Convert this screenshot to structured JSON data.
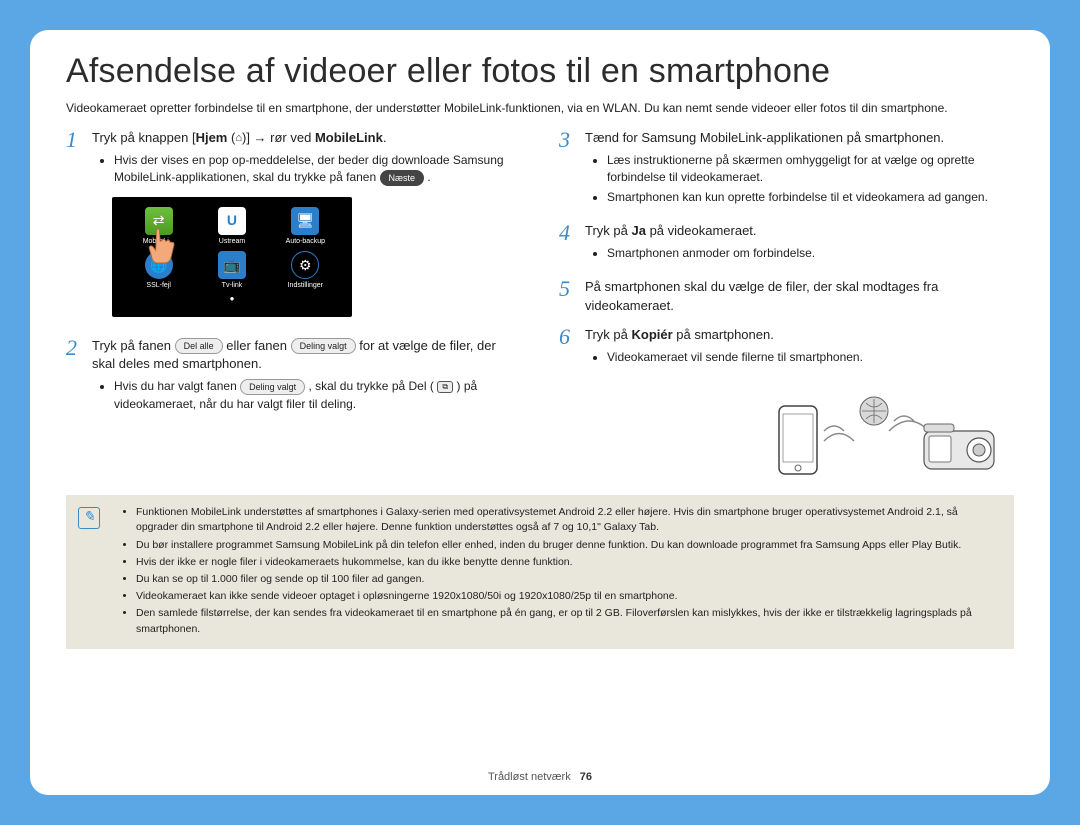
{
  "title": "Afsendelse af videoer eller fotos til en smartphone",
  "intro": "Videokameraet opretter forbindelse til en smartphone, der understøtter MobileLink-funktionen, via en WLAN. Du kan nemt sende videoer eller fotos til din smartphone.",
  "steps": {
    "s1": {
      "num": "1",
      "pre": "Tryk på knappen [",
      "hjem": "Hjem",
      "home_icon": "⌂",
      "post": ")] → rør ved ",
      "ml": "MobileLink",
      "bullet_a": "Hvis der vises en pop op-meddelelse, der beder dig downloade Samsung MobileLink-applikationen, skal du trykke på fanen",
      "pill_next": "Næste"
    },
    "s2": {
      "num": "2",
      "pre": "Tryk på fanen ",
      "pill_all": "Del alle",
      "mid": " eller fanen ",
      "pill_sel": "Deling valgt",
      "post": " for at vælge de filer, der skal deles med smartphonen.",
      "bullet_pre": "Hvis du har valgt fanen ",
      "bullet_pill": "Deling valgt",
      "bullet_mid": ", skal du trykke på Del (",
      "bullet_post": ") på videokameraet, når du har valgt filer til deling."
    },
    "s3": {
      "num": "3",
      "main": "Tænd for Samsung MobileLink-applikationen på smartphonen.",
      "b1": "Læs instruktionerne på skærmen omhyggeligt for at vælge og oprette forbindelse til videokameraet.",
      "b2": "Smartphonen kan kun oprette forbindelse til et videokamera ad gangen."
    },
    "s4": {
      "num": "4",
      "pre": "Tryk på ",
      "ja": "Ja",
      "post": " på videokameraet.",
      "b1": "Smartphonen anmoder om forbindelse."
    },
    "s5": {
      "num": "5",
      "main": "På smartphonen skal du vælge de filer, der skal modtages fra videokameraet."
    },
    "s6": {
      "num": "6",
      "pre": "Tryk på ",
      "kopier": "Kopiér",
      "post": " på smartphonen.",
      "b1": "Videokameraet vil sende filerne til smartphonen."
    }
  },
  "screen": {
    "apps": [
      "MobileLi...",
      "Ustream",
      "Auto-backup",
      "SSL-fejl",
      "Tv-link",
      "Indstillinger"
    ],
    "u_letter": "U"
  },
  "notes": {
    "n1": "Funktionen MobileLink understøttes af smartphones i Galaxy-serien med operativsystemet Android 2.2 eller højere. Hvis din smartphone bruger operativsystemet Android 2.1, så opgrader din smartphone til Android 2.2 eller højere. Denne funktion understøttes også af 7 og 10,1\" Galaxy Tab.",
    "n2": "Du bør installere programmet Samsung MobileLink på din telefon eller enhed, inden du bruger denne funktion. Du kan downloade programmet fra Samsung Apps eller Play Butik.",
    "n3": "Hvis der ikke er nogle filer i videokameraets hukommelse, kan du ikke benytte denne funktion.",
    "n4": "Du kan se op til 1.000 filer og sende op til 100 filer ad gangen.",
    "n5": "Videokameraet kan ikke sende videoer optaget i opløsningerne 1920x1080/50i og 1920x1080/25p til en smartphone.",
    "n6": "Den samlede filstørrelse, der kan sendes fra videokameraet til en smartphone på én gang, er op til 2 GB. Filoverførslen kan mislykkes, hvis der ikke er tilstrækkelig lagringsplads på smartphonen."
  },
  "footer": {
    "section": "Trådløst netværk",
    "page": "76"
  }
}
